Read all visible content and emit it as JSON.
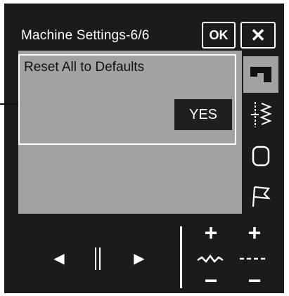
{
  "header": {
    "title": "Machine Settings-6/6",
    "ok_label": "OK",
    "close_label": "✕"
  },
  "setting": {
    "label": "Reset All to Defaults",
    "yes_label": "YES"
  },
  "tabs": [
    {
      "name": "sewing-machine-icon",
      "active": true
    },
    {
      "name": "stitch-icon",
      "active": false
    },
    {
      "name": "bobbin-icon",
      "active": false
    },
    {
      "name": "flag-icon",
      "active": false
    }
  ],
  "controls": {
    "prev": "◀",
    "next": "▶",
    "plus": "+",
    "minus": "−"
  }
}
